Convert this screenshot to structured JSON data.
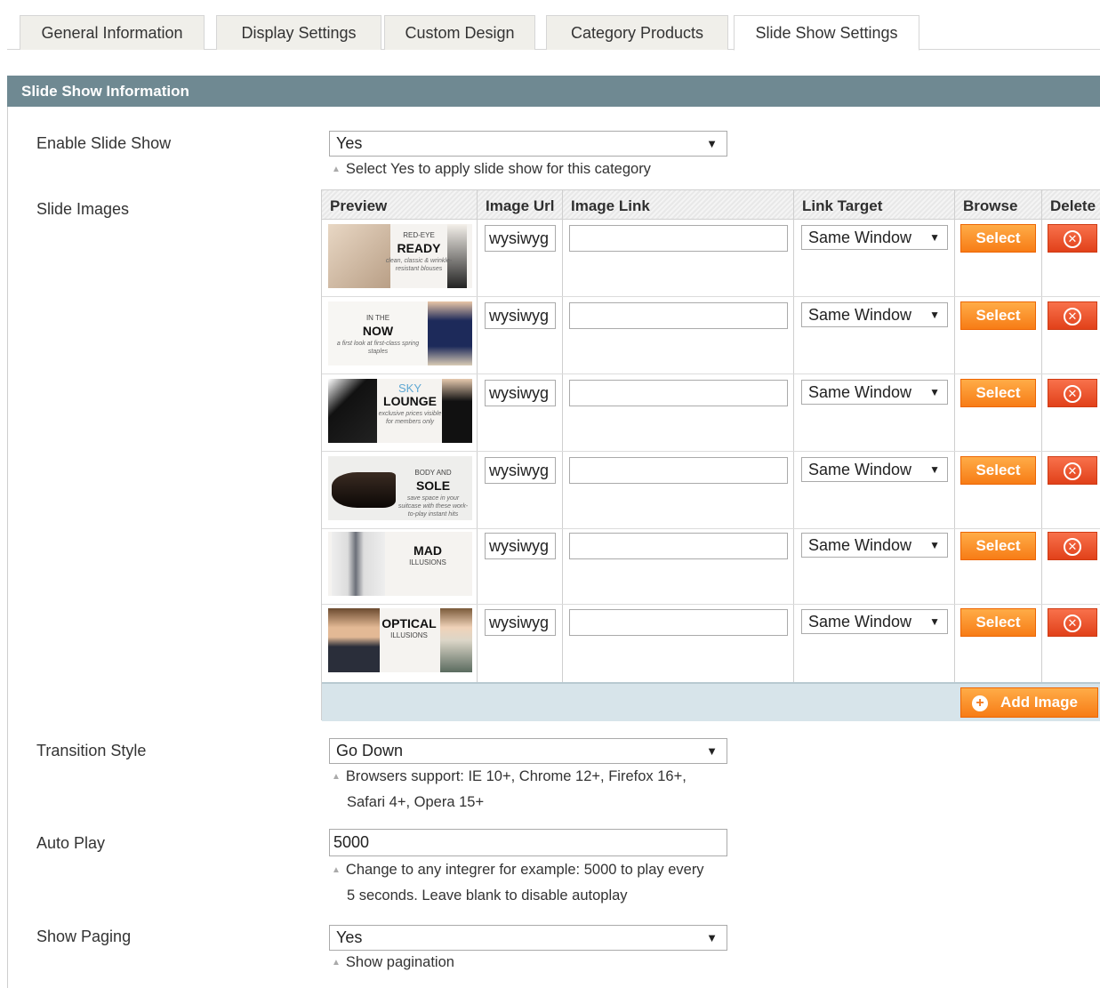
{
  "tabs": [
    {
      "label": "General Information"
    },
    {
      "label": "Display Settings"
    },
    {
      "label": "Custom Design"
    },
    {
      "label": "Category Products"
    },
    {
      "label": "Slide Show Settings"
    }
  ],
  "active_tab": "Slide Show Settings",
  "section": {
    "title": "Slide Show Information"
  },
  "enable_slideshow": {
    "label": "Enable Slide Show",
    "value": "Yes",
    "note": "Select Yes to apply slide show for this category"
  },
  "slide_images": {
    "label": "Slide Images",
    "columns": {
      "preview": "Preview",
      "image_url": "Image Url",
      "image_link": "Image Link",
      "link_target": "Link Target",
      "browse": "Browse",
      "delete": "Delete"
    },
    "rows": [
      {
        "image_url": "wysiwyg",
        "image_link": "",
        "link_target": "Same Window",
        "select_label": "Select",
        "preview": {
          "small": "RED-EYE",
          "title": "READY",
          "sub": "clean, classic & wrinkle-resistant blouses"
        }
      },
      {
        "image_url": "wysiwyg",
        "image_link": "",
        "link_target": "Same Window",
        "select_label": "Select",
        "preview": {
          "small": "IN THE",
          "title": "NOW",
          "sub": "a first look at first-class spring staples"
        }
      },
      {
        "image_url": "wysiwyg",
        "image_link": "",
        "link_target": "Same Window",
        "select_label": "Select",
        "preview": {
          "small": "SKY",
          "title": "LOUNGE",
          "sub": "exclusive prices visible for members only"
        }
      },
      {
        "image_url": "wysiwyg",
        "image_link": "",
        "link_target": "Same Window",
        "select_label": "Select",
        "preview": {
          "small": "BODY AND",
          "title": "SOLE",
          "sub": "save space in your suitcase with these work-to-play instant hits"
        }
      },
      {
        "image_url": "wysiwyg",
        "image_link": "",
        "link_target": "Same Window",
        "select_label": "Select",
        "preview": {
          "small": "",
          "title": "MAD",
          "sub": "ILLUSIONS"
        }
      },
      {
        "image_url": "wysiwyg",
        "image_link": "",
        "link_target": "Same Window",
        "select_label": "Select",
        "preview": {
          "small": "",
          "title": "OPTICAL",
          "sub": "ILLUSIONS"
        }
      }
    ],
    "add_button": "Add Image"
  },
  "transition_style": {
    "label": "Transition Style",
    "value": "Go Down",
    "note_line1": "Browsers support: IE 10+, Chrome 12+, Firefox 16+,",
    "note_line2": "Safari 4+, Opera 15+"
  },
  "auto_play": {
    "label": "Auto Play",
    "value": "5000",
    "note_line1": "Change to any integrer for example: 5000 to play every",
    "note_line2": "5 seconds. Leave blank to disable autoplay"
  },
  "show_paging": {
    "label": "Show Paging",
    "value": "Yes",
    "note": "Show pagination"
  },
  "colors": {
    "header_bg": "#6f8992",
    "orange_button": "#f77c16",
    "delete_button": "#e1411a",
    "grid_footer": "#d7e4ea"
  }
}
